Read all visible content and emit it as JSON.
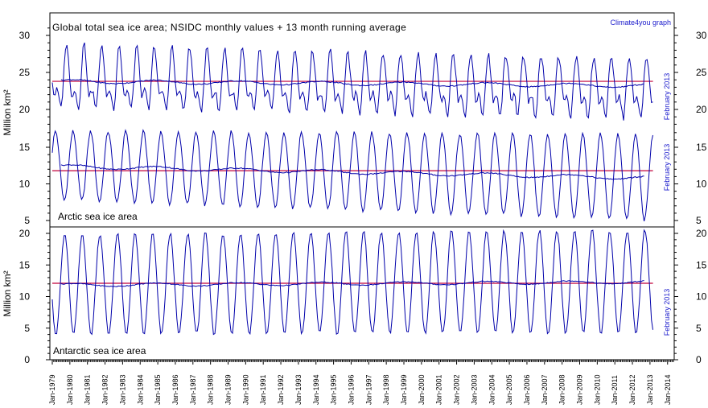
{
  "chart_data": {
    "type": "line",
    "title": "Global total sea ice area; NSIDC monthly values + 13 month running average",
    "credit": "Climate4you graph",
    "date_label": "February 2013",
    "ylabel": "Million km²",
    "x_categories": [
      "Jan-1979",
      "Jan-1980",
      "Jan-1981",
      "Jan-1982",
      "Jan-1983",
      "Jan-1984",
      "Jan-1985",
      "Jan-1986",
      "Jan-1987",
      "Jan-1988",
      "Jan-1989",
      "Jan-1990",
      "Jan-1991",
      "Jan-1992",
      "Jan-1993",
      "Jan-1994",
      "Jan-1995",
      "Jan-1996",
      "Jan-1997",
      "Jan-1998",
      "Jan-1999",
      "Jan-2000",
      "Jan-2001",
      "Jan-2002",
      "Jan-2003",
      "Jan-2004",
      "Jan-2005",
      "Jan-2006",
      "Jan-2007",
      "Jan-2008",
      "Jan-2009",
      "Jan-2010",
      "Jan-2011",
      "Jan-2012",
      "Jan-2013",
      "Jan-2014"
    ],
    "panels": [
      {
        "name": "global",
        "ylim": [
          17.5,
          31.5
        ],
        "yticks": [
          20,
          25,
          30
        ],
        "reference_mean": 23.8,
        "series": [
          {
            "kind": "monthly",
            "color": "#0000aa",
            "mean_start": 23.9,
            "mean_end": 23.3,
            "amp_peak_start": 4.4,
            "amp_peak_end": 2.9,
            "amp_trough_start": 4.7,
            "amp_trough_end": 6.1,
            "min_value": 16.9,
            "max_value": 28.2
          },
          {
            "kind": "running_mean_13m",
            "color": "#0000aa",
            "start": 23.8,
            "end": 23.2
          }
        ]
      },
      {
        "name": "arctic",
        "label": "Arctic sea ice area",
        "ylim": [
          5,
          17.2
        ],
        "yticks": [
          5,
          10,
          15
        ],
        "reference_mean": 11.8,
        "series": [
          {
            "kind": "monthly",
            "color": "#0000aa",
            "mean_start": 12.5,
            "mean_end": 10.9,
            "max_start": 16.5,
            "max_end": 15.1,
            "min_start": 7.1,
            "min_end": 3.4
          },
          {
            "kind": "running_mean_13m",
            "color": "#0000aa",
            "start": 12.4,
            "end": 10.8
          }
        ]
      },
      {
        "name": "antarctic",
        "label": "Antarctic sea ice area",
        "ylim": [
          0,
          20
        ],
        "yticks": [
          0,
          5,
          10,
          15,
          20
        ],
        "reference_mean": 12.1,
        "series": [
          {
            "kind": "monthly",
            "color": "#0000aa",
            "mean_start": 11.9,
            "mean_end": 12.4,
            "max_start": 18.7,
            "max_end": 19.4,
            "min_start": 2.8,
            "min_end": 3.0
          },
          {
            "kind": "running_mean_13m",
            "color": "#0000aa",
            "start": 11.8,
            "end": 12.3
          }
        ]
      }
    ],
    "reference_line_color": "#c0003a",
    "grid": false
  }
}
